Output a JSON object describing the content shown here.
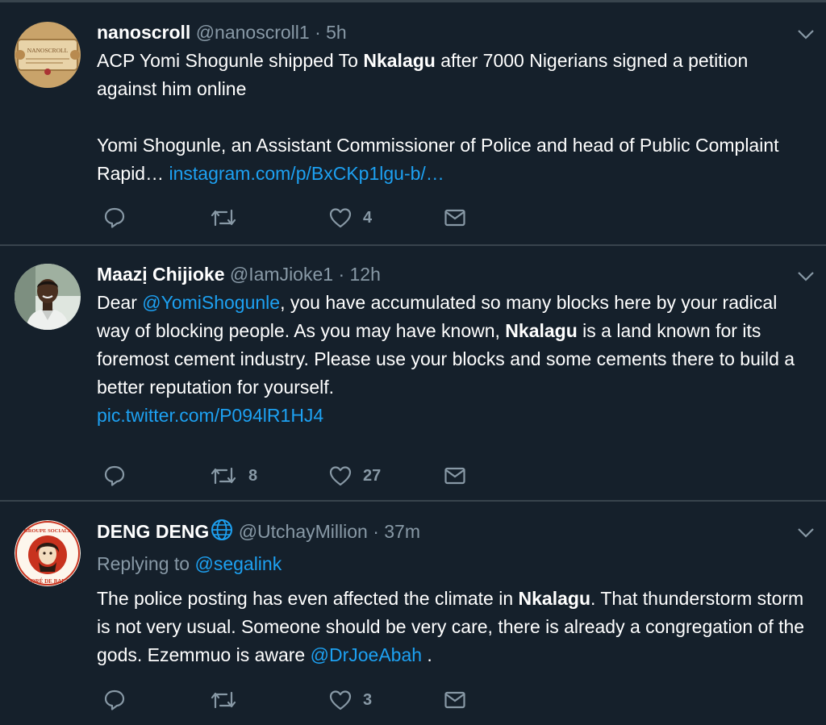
{
  "tweets": [
    {
      "name": "nanoscroll",
      "handle": "@nanoscroll1",
      "separator": "·",
      "time": "5h",
      "avatar_text": "NANOSCROLL",
      "line1_pre": "ACP Yomi Shogunle shipped To ",
      "line1_bold": "Nkalagu",
      "line1_post": " after 7000 Nigerians signed a petition against him online",
      "para2_text": "Yomi Shogunle, an Assistant Commissioner of Police and head of Public Complaint Rapid… ",
      "para2_link": "instagram.com/p/BxCKp1lgu-b/…",
      "replies": "",
      "retweets": "",
      "likes": "4"
    },
    {
      "name": "Maazị Chijioke",
      "handle": "@IamJioke1",
      "separator": "·",
      "time": "12h",
      "text_pre": "Dear ",
      "mention": "@YomiShogunle",
      "text_mid": ", you have accumulated so many blocks here by your radical way of blocking people. As you may have known, ",
      "bold": "Nkalagu",
      "text_post": " is a land known for its foremost cement industry. Please use your blocks and some cements there to build a better reputation for yourself.",
      "pic_link": "pic.twitter.com/P094lR1HJ4",
      "replies": "",
      "retweets": "8",
      "likes": "27"
    },
    {
      "name": "DENG DENG",
      "handle": "@UtchayMillion",
      "separator": "·",
      "time": "37m",
      "avatar_top_text": "GROUPE SOCIALE",
      "avatar_side_text": "HONORÉ DE BALZAC",
      "replying_label": "Replying to ",
      "replying_to": "@segalink",
      "text_pre": "The police posting has even affected the climate in ",
      "bold": "Nkalagu",
      "text_mid": ". That thunderstorm storm is not very usual. Someone should be very care, there is already a congregation of the gods. Ezemmuo is aware ",
      "mention": "@DrJoeAbah",
      "text_post": " .",
      "replies": "",
      "retweets": "",
      "likes": "3"
    }
  ],
  "icons": {
    "reply": "reply-icon",
    "retweet": "retweet-icon",
    "like": "heart-icon",
    "share": "envelope-icon",
    "menu": "chevron-down-icon",
    "globe": "globe-icon"
  },
  "colors": {
    "background": "#15202b",
    "divider": "#38444d",
    "text": "#ffffff",
    "muted": "#8899a6",
    "link": "#1da1f2"
  }
}
